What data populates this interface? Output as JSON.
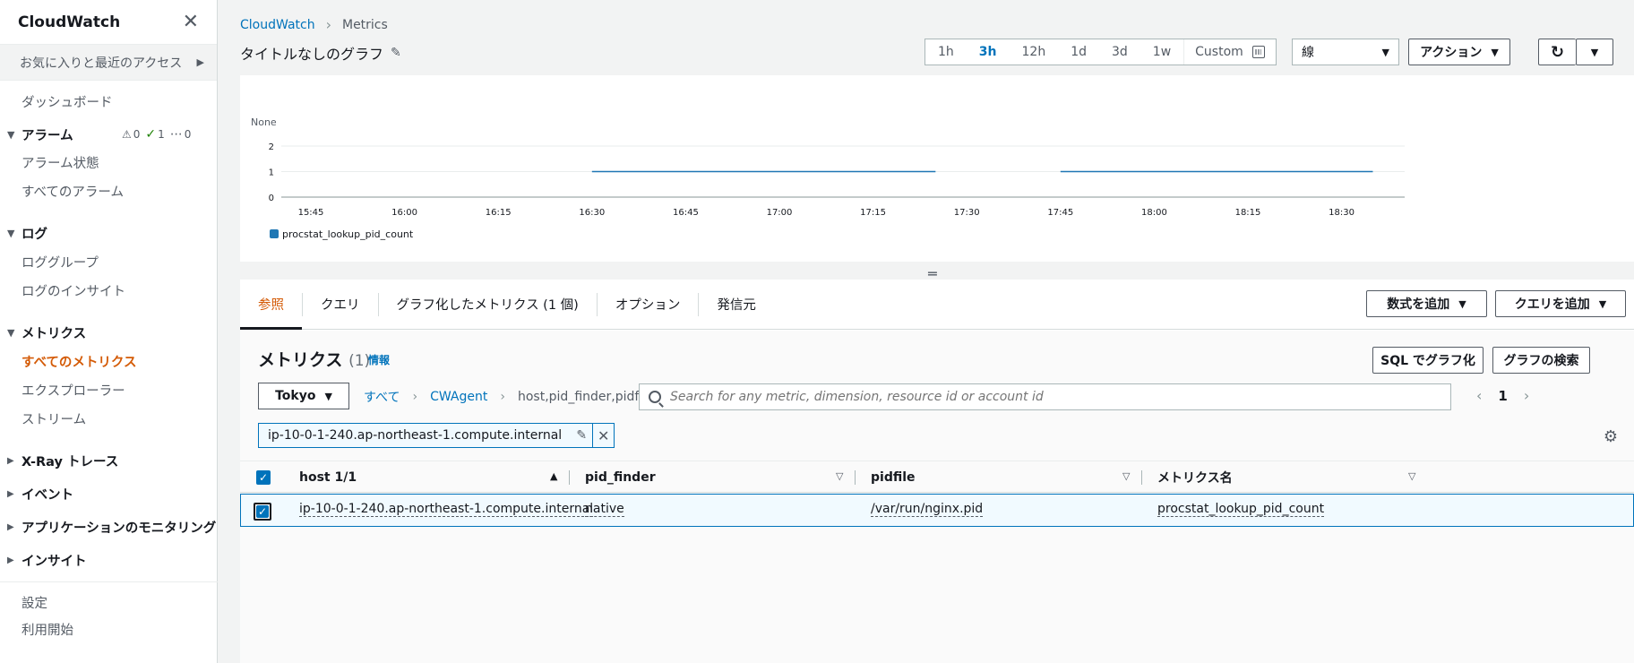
{
  "sidebar": {
    "title": "CloudWatch",
    "favorites": "お気に入りと最近のアクセス",
    "dashboard": "ダッシュボード",
    "alarm": {
      "label": "アラーム",
      "warn": "0",
      "ok": "1",
      "other": "0",
      "state": "アラーム状態",
      "all": "すべてのアラーム"
    },
    "logs": {
      "label": "ログ",
      "groups": "ロググループ",
      "insights": "ログのインサイト"
    },
    "metrics": {
      "label": "メトリクス",
      "all": "すべてのメトリクス",
      "explorer": "エクスプローラー",
      "streams": "ストリーム"
    },
    "xray": "X-Ray トレース",
    "events": "イベント",
    "app_monitoring": "アプリケーションのモニタリング",
    "insights": "インサイト",
    "settings": "設定",
    "getting_started": "利用開始"
  },
  "breadcrumb": {
    "root": "CloudWatch",
    "current": "Metrics"
  },
  "graph_title": "タイトルなしのグラフ",
  "timebar": {
    "ranges": [
      "1h",
      "3h",
      "12h",
      "1d",
      "3d",
      "1w"
    ],
    "active": "3h",
    "custom": "Custom"
  },
  "graph_type": "線",
  "actions_label": "アクション",
  "chart_data": {
    "type": "line",
    "ylabel": "None",
    "yticks": [
      "2",
      "1",
      "0"
    ],
    "ylim": [
      0,
      2
    ],
    "xticks": [
      "15:45",
      "16:00",
      "16:15",
      "16:30",
      "16:45",
      "17:00",
      "17:15",
      "17:30",
      "17:45",
      "18:00",
      "18:15",
      "18:30"
    ],
    "series": [
      {
        "name": "procstat_lookup_pid_count",
        "color": "#1f77b4",
        "segments": [
          {
            "from": "16:30",
            "to": "17:25",
            "value": 1
          },
          {
            "from": "17:45",
            "to": "18:35",
            "value": 1
          }
        ]
      }
    ]
  },
  "tabs": [
    "参照",
    "クエリ",
    "グラフ化したメトリクス (1 個)",
    "オプション",
    "発信元"
  ],
  "add_math": "数式を追加",
  "add_query": "クエリを追加",
  "metrics_panel": {
    "title": "メトリクス",
    "count": "(1)",
    "info": "情報",
    "sql_button": "SQL でグラフ化",
    "search_graphs": "グラフの検索",
    "region": "Tokyo",
    "path": [
      "すべて",
      "CWAgent",
      "host,pid_finder,pidfile"
    ],
    "search_placeholder": "Search for any metric, dimension, resource id or account id",
    "page": "1",
    "filter_chip": "ip-10-0-1-240.ap-northeast-1.compute.internal",
    "columns": [
      "host 1/1",
      "pid_finder",
      "pidfile",
      "メトリクス名"
    ],
    "rows": [
      {
        "host": "ip-10-0-1-240.ap-northeast-1.compute.internal",
        "pid_finder": "native",
        "pidfile": "/var/run/nginx.pid",
        "metric": "procstat_lookup_pid_count"
      }
    ]
  }
}
